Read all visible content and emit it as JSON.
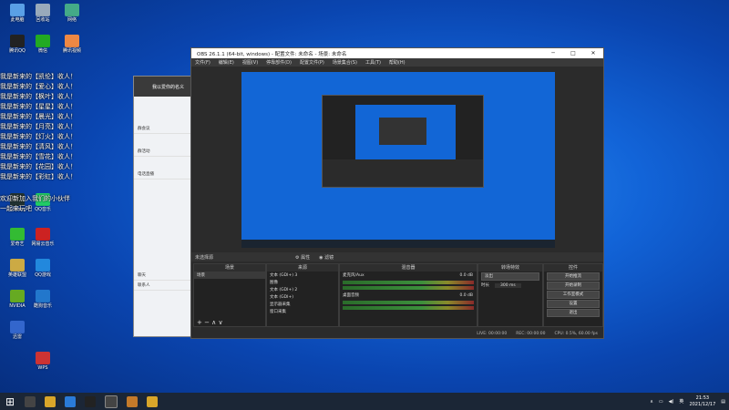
{
  "desktop": {
    "icons": [
      {
        "label": "此电脑",
        "color": "#5aa0e6"
      },
      {
        "label": "回收站",
        "color": "#9ab"
      },
      {
        "label": "网络",
        "color": "#4a8"
      },
      {
        "label": "腾讯QQ",
        "color": "#222"
      },
      {
        "label": "微信",
        "color": "#2a2"
      },
      {
        "label": "腾讯视频",
        "color": "#e84"
      },
      {
        "label": "Steam",
        "color": "#233"
      },
      {
        "label": "QQ音乐",
        "color": "#2c6"
      },
      {
        "label": "爱奇艺",
        "color": "#3b3"
      },
      {
        "label": "网易云音乐",
        "color": "#c22"
      },
      {
        "label": "英雄联盟",
        "color": "#ca4"
      },
      {
        "label": "QQ游戏",
        "color": "#28d"
      },
      {
        "label": "NVIDIA",
        "color": "#6a2"
      },
      {
        "label": "酷狗音乐",
        "color": "#27c"
      },
      {
        "label": "迅雷",
        "color": "#36c"
      },
      {
        "label": "WPS",
        "color": "#c33"
      }
    ],
    "overlay_lines": [
      "我是新来的【凯伦】收人！",
      "我是新来的【爱心】收人！",
      "我是新来的【枫叶】收人！",
      "我是新来的【星星】收人！",
      "我是新来的【晨光】收人！",
      "我是新来的【月亮】收人！",
      "我是新来的【灯火】收人！",
      "我是新来的【清风】收人！",
      "我是新来的【雪花】收人！",
      "我是新来的【花园】收人！",
      "我是新来的【彩虹】收人！",
      "欢迎新加入我们的小伙伴",
      "一起来玩吧"
    ]
  },
  "qq_window": {
    "title": "我以爱你的名义",
    "items": [
      "群会议",
      "群活动",
      "电话直播",
      "QQ空间",
      "好友",
      "我的设备",
      "聊天",
      "联系人"
    ]
  },
  "obs": {
    "title": "OBS 26.1.1 (64-bit, windows) - 配置文件: 未命名 - 场景: 未命名",
    "menu": [
      "文件(F)",
      "编辑(E)",
      "视图(V)",
      "停靠部件(D)",
      "配置文件(P)",
      "场景集合(S)",
      "工具(T)",
      "帮助(H)"
    ],
    "scene_bar": {
      "left": "未选择源",
      "props": "属性",
      "filters": "滤镜"
    },
    "docks": {
      "scenes": {
        "title": "场景",
        "items": [
          "场景"
        ]
      },
      "sources": {
        "title": "来源",
        "items": [
          "文本 (GDI+) 3",
          "图像",
          "文本 (GDI+) 2",
          "文本 (GDI+)",
          "显示器采集",
          "窗口采集"
        ]
      },
      "mixer": {
        "title": "混音器",
        "tracks": [
          {
            "name": "麦克风/Aux",
            "db": "0.0 dB"
          },
          {
            "name": "桌面音频",
            "db": "0.0 dB"
          }
        ]
      },
      "transitions": {
        "title": "转场特效",
        "mode": "淡出",
        "duration_label": "时长",
        "duration": "300 ms"
      },
      "controls": {
        "title": "控件",
        "buttons": [
          "开始推流",
          "开始录制",
          "工作室模式",
          "设置",
          "退出"
        ]
      }
    },
    "status": {
      "live": "LIVE: 00:00:00",
      "rec": "REC: 00:00:00",
      "cpu": "CPU: 0.5%, 60.00 fps"
    }
  },
  "taskbar": {
    "time": "21:53",
    "date": "2021/12/17",
    "lang": "英"
  }
}
